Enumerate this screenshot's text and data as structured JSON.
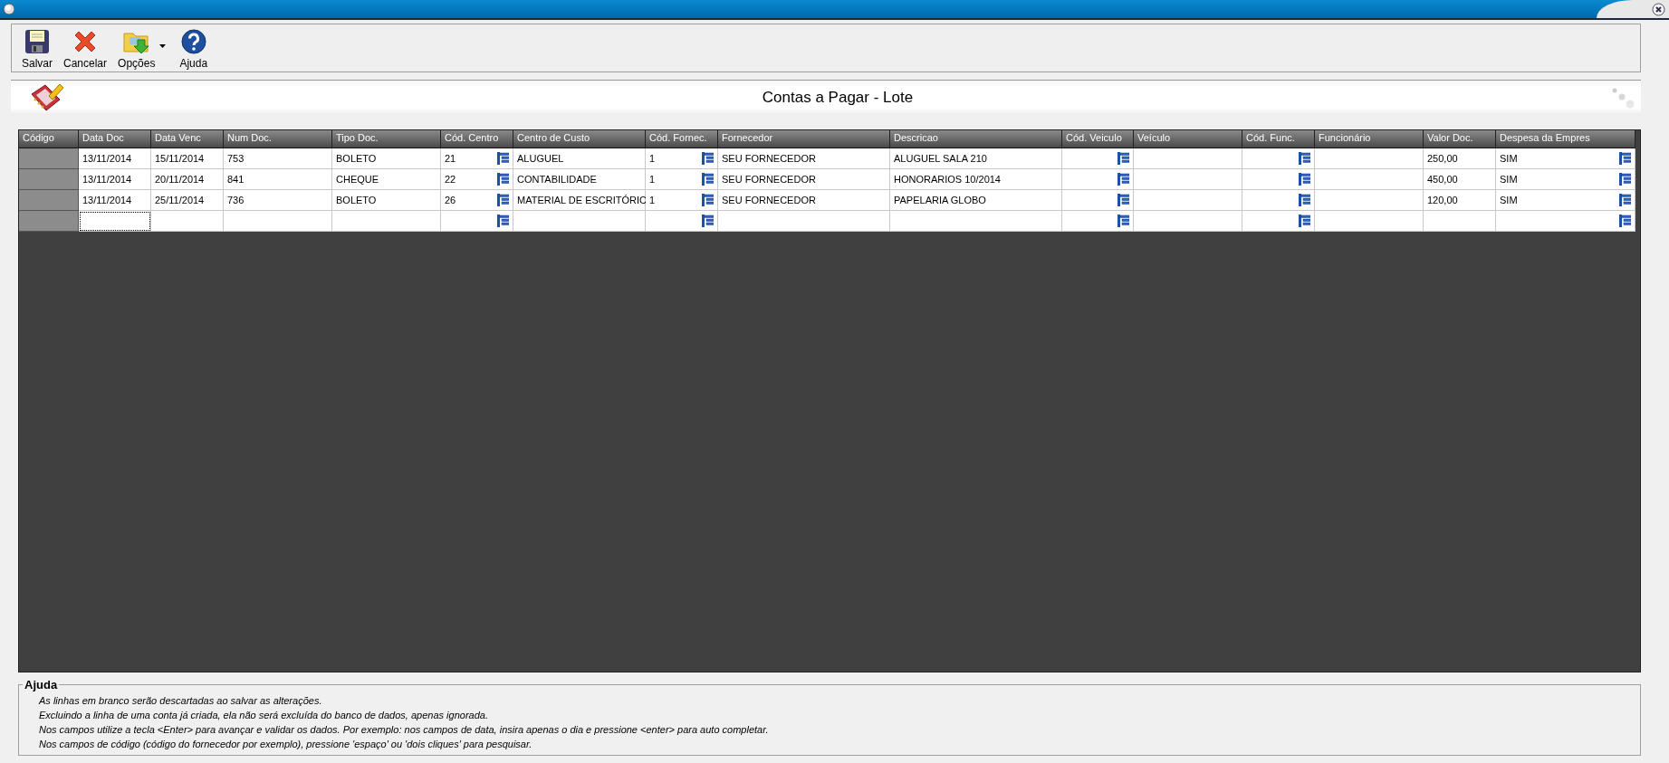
{
  "toolbar": [
    {
      "kind": "save",
      "label": "Salvar",
      "has_menu": false
    },
    {
      "kind": "cancel",
      "label": "Cancelar",
      "has_menu": false
    },
    {
      "kind": "options",
      "label": "Opções",
      "has_menu": true
    },
    {
      "kind": "help",
      "label": "Ajuda",
      "has_menu": false
    }
  ],
  "page_title": "Contas a Pagar - Lote",
  "grid": {
    "columns": [
      {
        "label": "Código",
        "lookup": false,
        "kind": "key"
      },
      {
        "label": "Data Doc",
        "lookup": false,
        "kind": "text"
      },
      {
        "label": "Data Venc",
        "lookup": false,
        "kind": "text"
      },
      {
        "label": "Num Doc.",
        "lookup": false,
        "kind": "text"
      },
      {
        "label": "Tipo Doc.",
        "lookup": false,
        "kind": "text"
      },
      {
        "label": "Cód. Centro",
        "lookup": true,
        "kind": "text"
      },
      {
        "label": "Centro de Custo",
        "lookup": false,
        "kind": "text"
      },
      {
        "label": "Cód. Fornec.",
        "lookup": true,
        "kind": "text"
      },
      {
        "label": "Fornecedor",
        "lookup": false,
        "kind": "text"
      },
      {
        "label": "Descricao",
        "lookup": false,
        "kind": "text"
      },
      {
        "label": "Cód. Veiculo",
        "lookup": true,
        "kind": "text"
      },
      {
        "label": "Veículo",
        "lookup": false,
        "kind": "text"
      },
      {
        "label": "Cód. Func.",
        "lookup": true,
        "kind": "text"
      },
      {
        "label": "Funcionário",
        "lookup": false,
        "kind": "text"
      },
      {
        "label": "Valor Doc.",
        "lookup": false,
        "kind": "text"
      },
      {
        "label": "Despesa da Empres",
        "lookup": true,
        "kind": "text"
      }
    ],
    "rows": [
      {
        "editing": false,
        "cells": [
          null,
          "13/11/2014",
          "15/11/2014",
          "753",
          "BOLETO",
          "21",
          "ALUGUEL",
          "1",
          "SEU FORNECEDOR",
          "ALUGUEL SALA 210",
          null,
          null,
          null,
          null,
          "250,00",
          "SIM"
        ]
      },
      {
        "editing": false,
        "cells": [
          null,
          "13/11/2014",
          "20/11/2014",
          "841",
          "CHEQUE",
          "22",
          "CONTABILIDADE",
          "1",
          "SEU FORNECEDOR",
          "HONORARIOS 10/2014",
          null,
          null,
          null,
          null,
          "450,00",
          "SIM"
        ]
      },
      {
        "editing": false,
        "cells": [
          null,
          "13/11/2014",
          "25/11/2014",
          "736",
          "BOLETO",
          "26",
          "MATERIAL DE ESCRITÓRIC",
          "1",
          "SEU FORNECEDOR",
          "PAPELARIA GLOBO",
          null,
          null,
          null,
          null,
          "120,00",
          "SIM"
        ]
      },
      {
        "editing": true,
        "cells": [
          null,
          null,
          null,
          null,
          null,
          null,
          null,
          null,
          null,
          null,
          null,
          null,
          null,
          null,
          null,
          null
        ]
      }
    ]
  },
  "help": {
    "title": "Ajuda",
    "lines": [
      "As linhas em branco serão descartadas ao salvar as alterações.",
      "Excluindo a linha de uma conta já criada, ela não será excluída do banco de dados, apenas ignorada.",
      "Nos campos utilize a tecla <Enter> para avançar e validar os dados. Por exemplo: nos campos de data, insira apenas o dia e pressione <enter> para auto completar.",
      "Nos campos de código (código do fornecedor por exemplo), pressione 'espaço' ou 'dois cliques' para pesquisar."
    ]
  }
}
